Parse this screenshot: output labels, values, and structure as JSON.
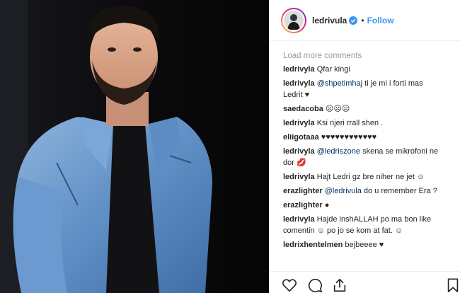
{
  "header": {
    "username": "ledrivula",
    "separator": "•",
    "follow_label": "Follow"
  },
  "comments": {
    "load_more": "Load more comments",
    "items": [
      {
        "user": "ledrivyla",
        "pre": " Qfar kingi",
        "mention": "",
        "post": ""
      },
      {
        "user": "ledrivyla",
        "pre": " ",
        "mention": "@shpetimhaj",
        "post": " ti je mi i forti mas Ledrit ♥"
      },
      {
        "user": "saedacoba",
        "pre": " ☹☹☹",
        "mention": "",
        "post": ""
      },
      {
        "user": "ledrivyla",
        "pre": " Ksi njeri rrall shen .",
        "mention": "",
        "post": ""
      },
      {
        "user": "eliigotaaa",
        "pre": " ♥♥♥♥♥♥♥♥♥♥♥♥",
        "mention": "",
        "post": ""
      },
      {
        "user": "ledrivyla",
        "pre": " ",
        "mention": "@ledriszone",
        "post": " skena se mikrofoni ne dor 💋"
      },
      {
        "user": "ledrivyla",
        "pre": " Hajt Ledri gz bre niher ne jet ☺",
        "mention": "",
        "post": ""
      },
      {
        "user": "erazlighter",
        "pre": " ",
        "mention": "@ledrivula",
        "post": " do u remember Era ?"
      },
      {
        "user": "erazlighter",
        "pre": " ●",
        "mention": "",
        "post": ""
      },
      {
        "user": "ledrivyla",
        "pre": " Hajde inshALLAH po ma bon like comentin ☺ po jo se kom at fat. ☺",
        "mention": "",
        "post": ""
      },
      {
        "user": "ledrixhentelmen",
        "pre": " bejbeeee ♥",
        "mention": "",
        "post": ""
      }
    ]
  },
  "actions": {
    "like_icon": "heart-icon",
    "comment_icon": "comment-icon",
    "share_icon": "share-icon",
    "save_icon": "bookmark-icon"
  },
  "colors": {
    "link_blue": "#3897f0",
    "mention_blue": "#003569",
    "verified_blue": "#3897f0",
    "muted": "#999999"
  }
}
